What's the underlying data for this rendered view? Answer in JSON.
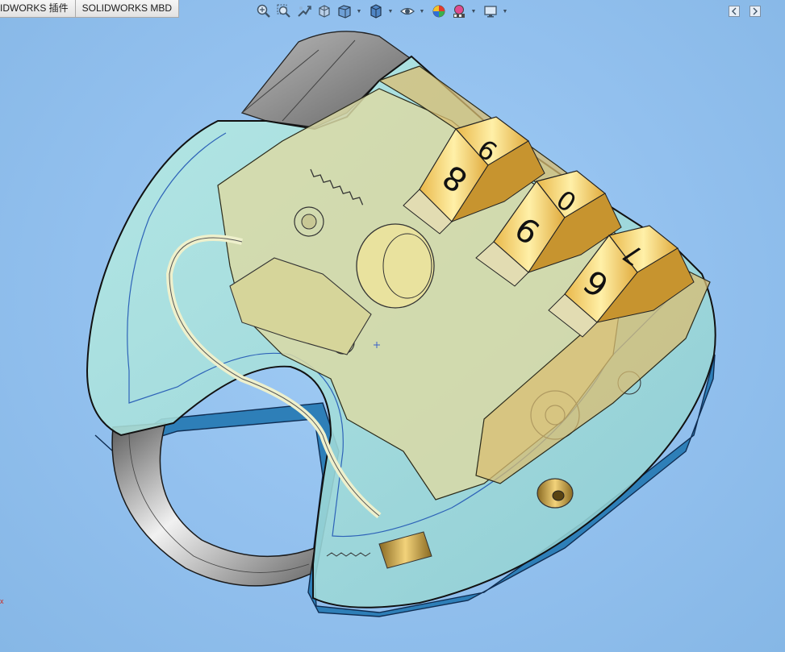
{
  "tabs": [
    {
      "label": "IDWORKS 插件"
    },
    {
      "label": "SOLIDWORKS MBD"
    }
  ],
  "heads_up_toolbar": [
    {
      "name": "zoom-to-fit-icon"
    },
    {
      "name": "zoom-to-area-icon"
    },
    {
      "name": "previous-view-icon"
    },
    {
      "name": "section-view-icon"
    },
    {
      "name": "view-orientation-icon",
      "dropdown": true
    },
    {
      "name": "display-style-icon",
      "dropdown": true
    },
    {
      "name": "hide-show-items-icon",
      "dropdown": true
    },
    {
      "name": "edit-appearance-icon"
    },
    {
      "name": "apply-scene-icon",
      "dropdown": true
    },
    {
      "name": "view-settings-icon",
      "dropdown": true
    }
  ],
  "window_controls": [
    {
      "name": "collapse-left-icon"
    },
    {
      "name": "expand-right-icon"
    }
  ],
  "model": {
    "dial_digits": [
      "9",
      "8",
      "0",
      "9",
      "7",
      "6"
    ]
  },
  "origin_marker": "x",
  "colors": {
    "background": "#95c2ee",
    "housing": "#aee0d8",
    "internals": "#d8d9a4",
    "brass": "#c8a24a",
    "dial_face": "#ffe07a",
    "shackle": "#9b9b9b",
    "base": "#2f7fb8"
  }
}
